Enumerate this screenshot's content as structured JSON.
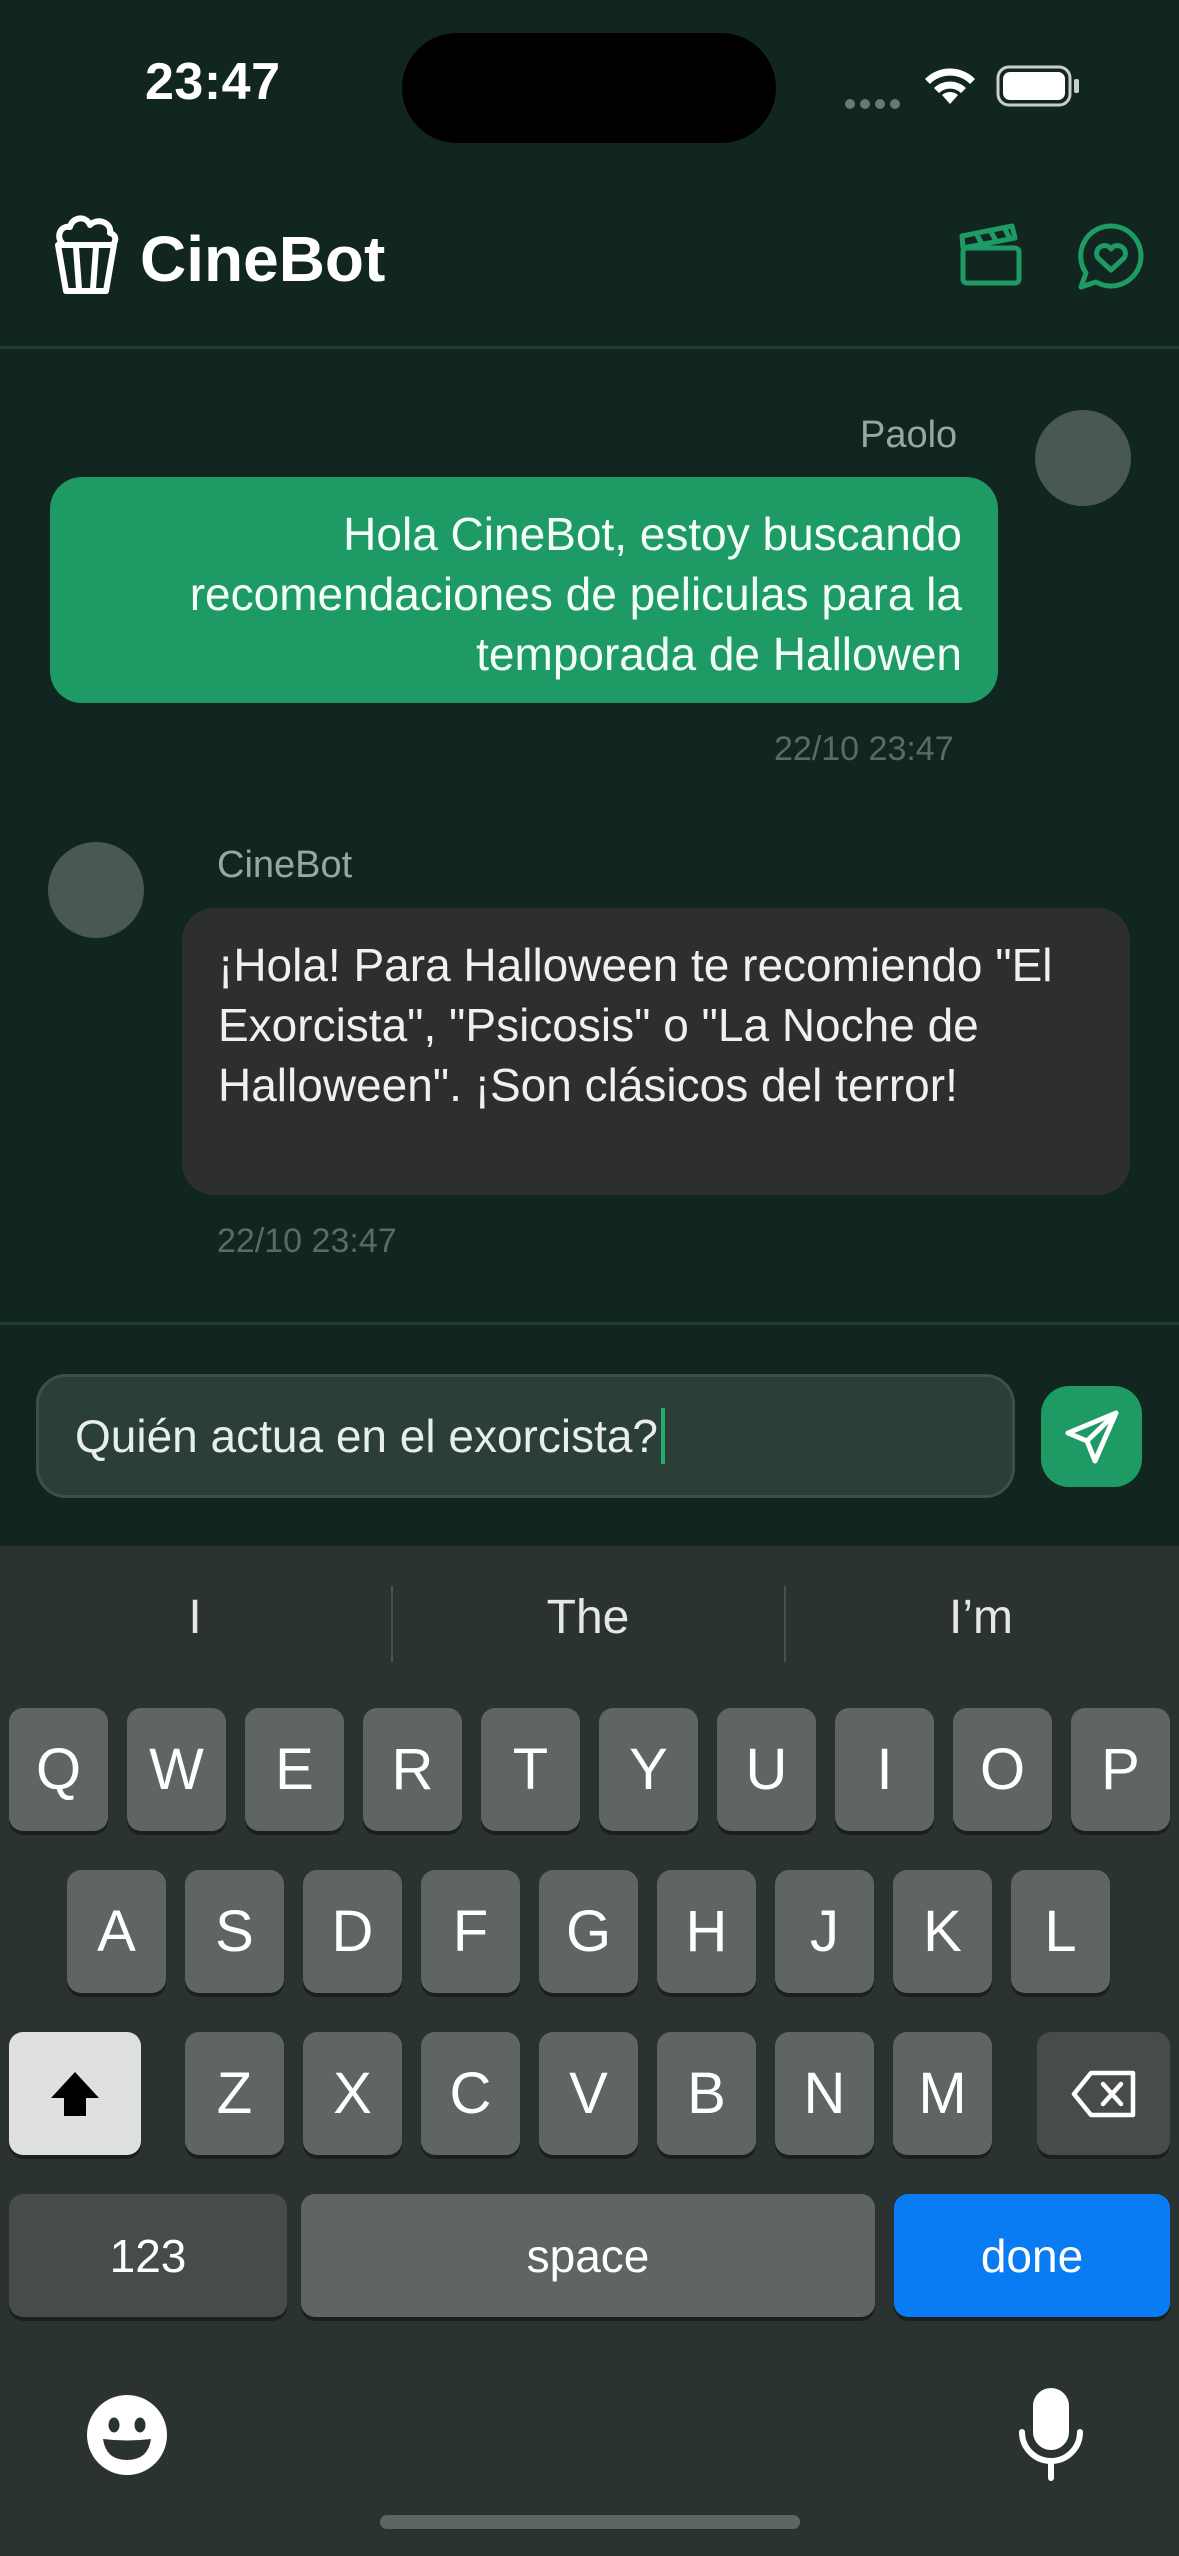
{
  "status_bar": {
    "time": "23:47"
  },
  "header": {
    "title": "CineBot",
    "accent_color": "#1e9b64"
  },
  "messages": [
    {
      "sender": "Paolo",
      "text": "Hola CineBot, estoy buscando recomendaciones de peliculas para la temporada de Hallowen",
      "timestamp": "22/10 23:47"
    },
    {
      "sender": "CineBot",
      "text": "¡Hola! Para Halloween te recomiendo \"El Exorcista\", \"Psicosis\" o \"La Noche de Halloween\". ¡Son clásicos del terror!",
      "timestamp": "22/10 23:47"
    }
  ],
  "composer": {
    "value": "Quién actua en el exorcista?"
  },
  "keyboard": {
    "suggestions": [
      "I",
      "The",
      "I’m"
    ],
    "row1": [
      "Q",
      "W",
      "E",
      "R",
      "T",
      "Y",
      "U",
      "I",
      "O",
      "P"
    ],
    "row2": [
      "A",
      "S",
      "D",
      "F",
      "G",
      "H",
      "J",
      "K",
      "L"
    ],
    "row3": [
      "Z",
      "X",
      "C",
      "V",
      "B",
      "N",
      "M"
    ],
    "numbers_label": "123",
    "space_label": "space",
    "done_label": "done"
  }
}
